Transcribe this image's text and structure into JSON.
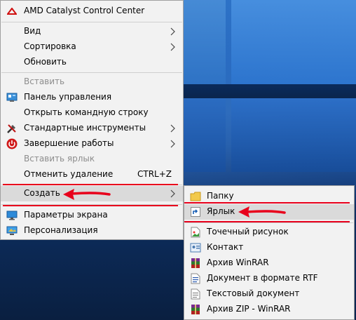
{
  "main_menu": {
    "items": [
      {
        "label": "AMD Catalyst Control Center",
        "icon": "amd-icon"
      },
      {
        "label": "Вид",
        "submenu": true
      },
      {
        "label": "Сортировка",
        "submenu": true
      },
      {
        "label": "Обновить"
      },
      {
        "label": "Вставить",
        "disabled": true
      },
      {
        "label": "Панель управления",
        "icon": "control-panel-icon"
      },
      {
        "label": "Открыть командную строку"
      },
      {
        "label": "Стандартные инструменты",
        "icon": "tools-icon",
        "submenu": true
      },
      {
        "label": "Завершение работы",
        "icon": "power-icon",
        "submenu": true
      },
      {
        "label": "Вставить ярлык",
        "disabled": true
      },
      {
        "label": "Отменить удаление",
        "shortcut": "CTRL+Z"
      },
      {
        "label": "Создать",
        "submenu": true,
        "highlighted": true
      },
      {
        "label": "Параметры экрана",
        "icon": "display-icon"
      },
      {
        "label": "Персонализация",
        "icon": "personalize-icon"
      }
    ]
  },
  "sub_menu": {
    "items": [
      {
        "label": "Папку",
        "icon": "folder-icon"
      },
      {
        "label": "Ярлык",
        "icon": "shortcut-icon",
        "highlighted": true
      },
      {
        "label": "Точечный рисунок",
        "icon": "bitmap-icon"
      },
      {
        "label": "Контакт",
        "icon": "contact-icon"
      },
      {
        "label": "Архив WinRAR",
        "icon": "winrar-icon"
      },
      {
        "label": "Документ в формате RTF",
        "icon": "rtf-icon"
      },
      {
        "label": "Текстовый документ",
        "icon": "text-doc-icon"
      },
      {
        "label": "Архив ZIP - WinRAR",
        "icon": "winrar-zip-icon"
      }
    ]
  },
  "colors": {
    "annotation": "#e8001c",
    "menu_bg": "#f2f2f2",
    "highlight": "#dadada"
  }
}
